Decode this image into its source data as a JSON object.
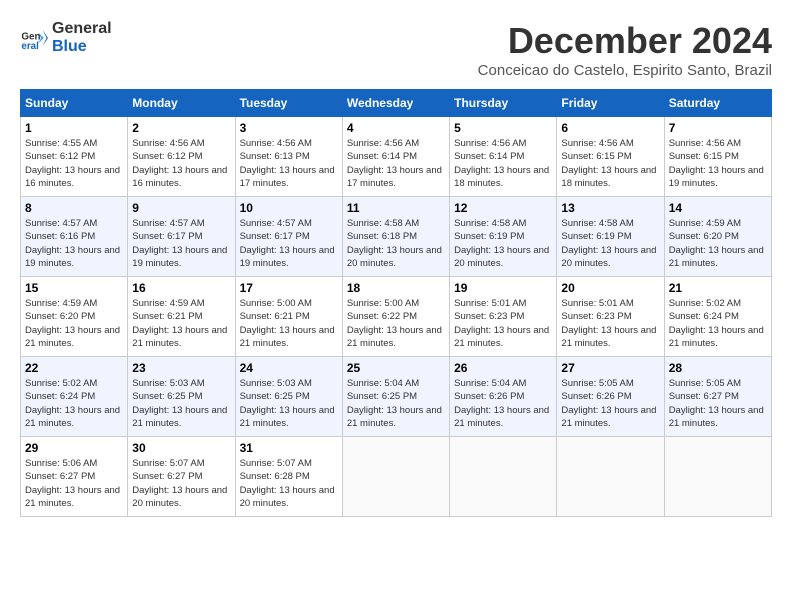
{
  "header": {
    "logo_line1": "General",
    "logo_line2": "Blue",
    "month": "December 2024",
    "location": "Conceicao do Castelo, Espirito Santo, Brazil"
  },
  "weekdays": [
    "Sunday",
    "Monday",
    "Tuesday",
    "Wednesday",
    "Thursday",
    "Friday",
    "Saturday"
  ],
  "weeks": [
    [
      {
        "day": "1",
        "sunrise": "4:55 AM",
        "sunset": "6:12 PM",
        "daylight": "13 hours and 16 minutes."
      },
      {
        "day": "2",
        "sunrise": "4:56 AM",
        "sunset": "6:12 PM",
        "daylight": "13 hours and 16 minutes."
      },
      {
        "day": "3",
        "sunrise": "4:56 AM",
        "sunset": "6:13 PM",
        "daylight": "13 hours and 17 minutes."
      },
      {
        "day": "4",
        "sunrise": "4:56 AM",
        "sunset": "6:14 PM",
        "daylight": "13 hours and 17 minutes."
      },
      {
        "day": "5",
        "sunrise": "4:56 AM",
        "sunset": "6:14 PM",
        "daylight": "13 hours and 18 minutes."
      },
      {
        "day": "6",
        "sunrise": "4:56 AM",
        "sunset": "6:15 PM",
        "daylight": "13 hours and 18 minutes."
      },
      {
        "day": "7",
        "sunrise": "4:56 AM",
        "sunset": "6:15 PM",
        "daylight": "13 hours and 19 minutes."
      }
    ],
    [
      {
        "day": "8",
        "sunrise": "4:57 AM",
        "sunset": "6:16 PM",
        "daylight": "13 hours and 19 minutes."
      },
      {
        "day": "9",
        "sunrise": "4:57 AM",
        "sunset": "6:17 PM",
        "daylight": "13 hours and 19 minutes."
      },
      {
        "day": "10",
        "sunrise": "4:57 AM",
        "sunset": "6:17 PM",
        "daylight": "13 hours and 19 minutes."
      },
      {
        "day": "11",
        "sunrise": "4:58 AM",
        "sunset": "6:18 PM",
        "daylight": "13 hours and 20 minutes."
      },
      {
        "day": "12",
        "sunrise": "4:58 AM",
        "sunset": "6:19 PM",
        "daylight": "13 hours and 20 minutes."
      },
      {
        "day": "13",
        "sunrise": "4:58 AM",
        "sunset": "6:19 PM",
        "daylight": "13 hours and 20 minutes."
      },
      {
        "day": "14",
        "sunrise": "4:59 AM",
        "sunset": "6:20 PM",
        "daylight": "13 hours and 21 minutes."
      }
    ],
    [
      {
        "day": "15",
        "sunrise": "4:59 AM",
        "sunset": "6:20 PM",
        "daylight": "13 hours and 21 minutes."
      },
      {
        "day": "16",
        "sunrise": "4:59 AM",
        "sunset": "6:21 PM",
        "daylight": "13 hours and 21 minutes."
      },
      {
        "day": "17",
        "sunrise": "5:00 AM",
        "sunset": "6:21 PM",
        "daylight": "13 hours and 21 minutes."
      },
      {
        "day": "18",
        "sunrise": "5:00 AM",
        "sunset": "6:22 PM",
        "daylight": "13 hours and 21 minutes."
      },
      {
        "day": "19",
        "sunrise": "5:01 AM",
        "sunset": "6:23 PM",
        "daylight": "13 hours and 21 minutes."
      },
      {
        "day": "20",
        "sunrise": "5:01 AM",
        "sunset": "6:23 PM",
        "daylight": "13 hours and 21 minutes."
      },
      {
        "day": "21",
        "sunrise": "5:02 AM",
        "sunset": "6:24 PM",
        "daylight": "13 hours and 21 minutes."
      }
    ],
    [
      {
        "day": "22",
        "sunrise": "5:02 AM",
        "sunset": "6:24 PM",
        "daylight": "13 hours and 21 minutes."
      },
      {
        "day": "23",
        "sunrise": "5:03 AM",
        "sunset": "6:25 PM",
        "daylight": "13 hours and 21 minutes."
      },
      {
        "day": "24",
        "sunrise": "5:03 AM",
        "sunset": "6:25 PM",
        "daylight": "13 hours and 21 minutes."
      },
      {
        "day": "25",
        "sunrise": "5:04 AM",
        "sunset": "6:25 PM",
        "daylight": "13 hours and 21 minutes."
      },
      {
        "day": "26",
        "sunrise": "5:04 AM",
        "sunset": "6:26 PM",
        "daylight": "13 hours and 21 minutes."
      },
      {
        "day": "27",
        "sunrise": "5:05 AM",
        "sunset": "6:26 PM",
        "daylight": "13 hours and 21 minutes."
      },
      {
        "day": "28",
        "sunrise": "5:05 AM",
        "sunset": "6:27 PM",
        "daylight": "13 hours and 21 minutes."
      }
    ],
    [
      {
        "day": "29",
        "sunrise": "5:06 AM",
        "sunset": "6:27 PM",
        "daylight": "13 hours and 21 minutes."
      },
      {
        "day": "30",
        "sunrise": "5:07 AM",
        "sunset": "6:27 PM",
        "daylight": "13 hours and 20 minutes."
      },
      {
        "day": "31",
        "sunrise": "5:07 AM",
        "sunset": "6:28 PM",
        "daylight": "13 hours and 20 minutes."
      },
      null,
      null,
      null,
      null
    ]
  ],
  "labels": {
    "sunrise": "Sunrise:",
    "sunset": "Sunset:",
    "daylight": "Daylight:"
  }
}
